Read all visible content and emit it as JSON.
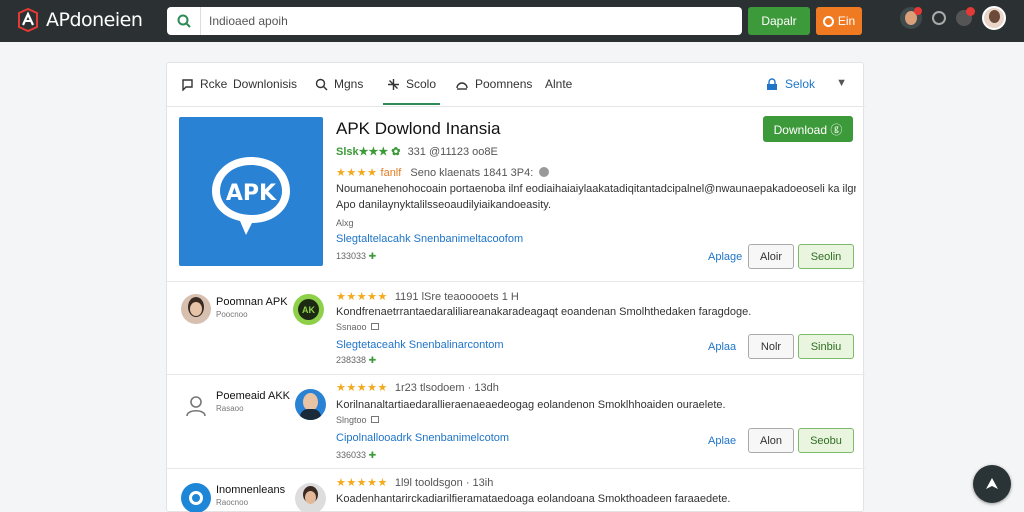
{
  "brand": {
    "name": "APdoneien",
    "accent": "#e53935"
  },
  "search": {
    "placeholder": "Indioaed apoih",
    "value": "Indioaed apoih"
  },
  "topbar": {
    "green_button": "Dapalr",
    "orange_button": "Ein",
    "icons": [
      "user-badge-icon",
      "settings-dot-icon",
      "notification-icon",
      "avatar"
    ]
  },
  "tabs": [
    {
      "label": "Rcke",
      "icon": "chat-icon"
    },
    {
      "label": "Downlonisis",
      "icon": ""
    },
    {
      "label": "Mgns",
      "icon": "search-icon"
    },
    {
      "label": "Scolo",
      "icon": "grid-icon",
      "active": true
    },
    {
      "label": "Poomnens",
      "icon": "speed-icon"
    },
    {
      "label": "Alnte",
      "icon": ""
    }
  ],
  "tab_right": {
    "label": "Selok",
    "icon": "lock-icon"
  },
  "featured": {
    "title": "APK Dowlond Inansia",
    "download_label": "Download ⓖ",
    "meta1_green": "Slsk★★★ ✿",
    "meta1_text": "331 @11123 oo8E",
    "meta2_stars": "★★★★",
    "meta2_label": "fanlf",
    "meta2_text": "Seno klaenats 1841 3P4:",
    "desc1": "Noumanehenohocoain portaenoba ilnf eodiaihaiaiylaakatadiqitantadcipalnel@nwaunaepakadoeoseli ka ilgra",
    "desc2": "Apo danilaynyktalilsseoaudilyiaikandoeasity.",
    "tag": "Alxg",
    "link": "Slegtaltelacahk Snenbanimeltacoofom",
    "count": "133033"
  },
  "actions": {
    "link_label": "Aplage",
    "btn_label": "Aloir",
    "btn2_label": "Seolin"
  },
  "rows": [
    {
      "name": "Poomnan APK",
      "sub": "Poocnoo",
      "stars": "★★★★★",
      "meta": "1191 lSre teaooooets 1 H",
      "desc": "Kondfrenaetrrantaedaraliliareanakaradeagaqt eoandenan Smolhthedaken faragdoge.",
      "tag": "Ssnaoo",
      "link": "Slegtetaceahk Snenbalinarcontom",
      "count": "238338",
      "link_label": "Aplaa",
      "btn_label": "Nolr",
      "btn2_label": "Sinbiu"
    },
    {
      "name": "Poemeaid AKK",
      "sub": "Rasaoo",
      "stars": "★★★★★",
      "meta": "1r23 tlsodoem · 13dh",
      "desc": "Korilnanaltartiaedarallieraenaeaedeogag eolandenon Smoklhhoaiden ouraelete.",
      "tag": "Slngtoo",
      "link": "Cipolnallooadrk Snenbanimelcotom",
      "count": "336033",
      "link_label": "Aplae",
      "btn_label": "Alon",
      "btn2_label": "Seobu"
    },
    {
      "name": "Inomnenleans",
      "sub": "Raocnoo",
      "stars": "★★★★★",
      "meta": "1l9l tooldsgon · 13ih",
      "desc": "Koadenhantarirckadiarilfieramataedoaga eolandoana Smokthoadeen faraaedete.",
      "tag": "",
      "link": "",
      "count": "",
      "link_label": "",
      "btn_label": "",
      "btn2_label": ""
    }
  ]
}
